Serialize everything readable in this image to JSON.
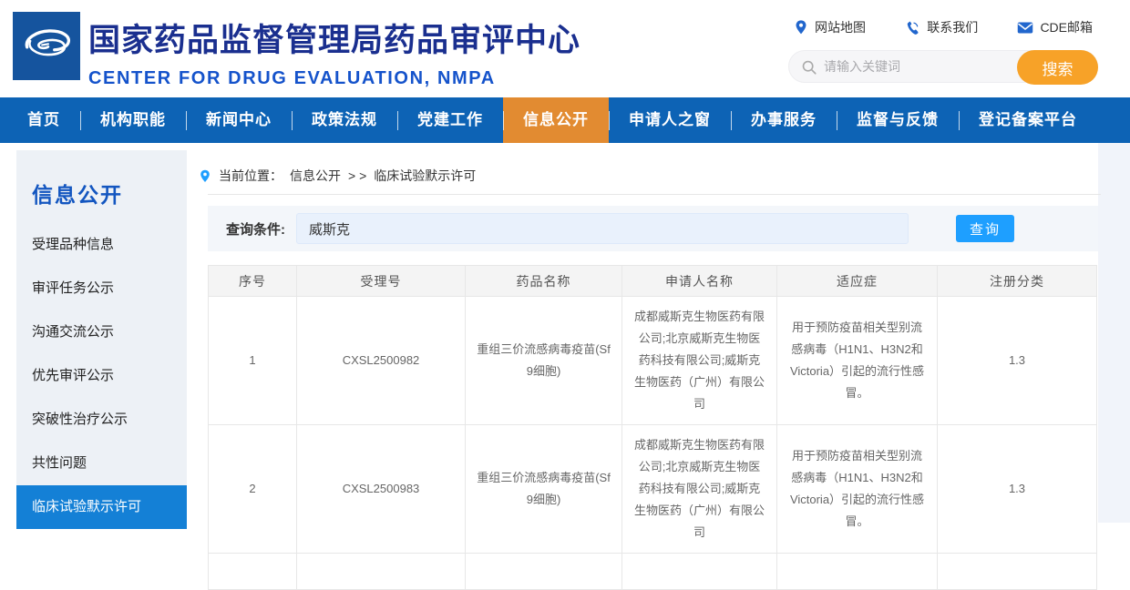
{
  "theme": {
    "logo-blue": "#15549e",
    "title-blue": "#1a2f8f",
    "subtitle-blue": "#1553cb",
    "icon-blue": "#2166cd",
    "search-orange": "#f7a228",
    "nav-blue": "#0d63b5",
    "nav-orange": "#e28b31",
    "sidebar-bg": "#edf1f6",
    "sidebar-title-blue": "#1356c0",
    "sidebar-active-blue": "#1480d6",
    "query-bg": "#f3f6fa",
    "query-input-bg": "#e9f1fc",
    "query-btn-blue": "#1e9fff",
    "th-bg": "#f4f4f4",
    "tbl-border": "#e7e7e7"
  },
  "header": {
    "title": "国家药品监督管理局药品审评中心",
    "subtitle": "CENTER FOR DRUG EVALUATION, NMPA",
    "quick_links": [
      {
        "label": "网站地图",
        "icon": "location-pin-icon"
      },
      {
        "label": "联系我们",
        "icon": "phone-icon"
      },
      {
        "label": "CDE邮箱",
        "icon": "envelope-icon"
      }
    ],
    "search": {
      "placeholder": "请输入关键词",
      "button_label": "搜索",
      "icon": "search-icon"
    }
  },
  "nav": {
    "items": [
      {
        "label": "首页",
        "active": false
      },
      {
        "label": "机构职能",
        "active": false
      },
      {
        "label": "新闻中心",
        "active": false
      },
      {
        "label": "政策法规",
        "active": false
      },
      {
        "label": "党建工作",
        "active": false
      },
      {
        "label": "信息公开",
        "active": true
      },
      {
        "label": "申请人之窗",
        "active": false
      },
      {
        "label": "办事服务",
        "active": false
      },
      {
        "label": "监督与反馈",
        "active": false
      },
      {
        "label": "登记备案平台",
        "active": false
      }
    ]
  },
  "sidebar": {
    "title": "信息公开",
    "items": [
      {
        "label": "受理品种信息",
        "active": false
      },
      {
        "label": "审评任务公示",
        "active": false
      },
      {
        "label": "沟通交流公示",
        "active": false
      },
      {
        "label": "优先审评公示",
        "active": false
      },
      {
        "label": "突破性治疗公示",
        "active": false
      },
      {
        "label": "共性问题",
        "active": false
      },
      {
        "label": "临床试验默示许可",
        "active": true
      }
    ]
  },
  "breadcrumb": {
    "prefix": "当前位置：",
    "section": "信息公开",
    "separator": ">  >",
    "current": "临床试验默示许可",
    "icon": "location-pin-icon"
  },
  "query": {
    "label": "查询条件:",
    "value": "威斯克",
    "button_label": "查询"
  },
  "table": {
    "columns": [
      "序号",
      "受理号",
      "药品名称",
      "申请人名称",
      "适应症",
      "注册分类"
    ],
    "rows": [
      {
        "seq": "1",
        "acceptance_no": "CXSL2500982",
        "drug_name": "重组三价流感病毒疫苗(Sf9细胞)",
        "applicant": "成都威斯克生物医药有限公司;北京威斯克生物医药科技有限公司;威斯克生物医药（广州）有限公司",
        "indication": "用于预防疫苗相关型别流感病毒（H1N1、H3N2和Victoria）引起的流行性感冒。",
        "category": "1.3"
      },
      {
        "seq": "2",
        "acceptance_no": "CXSL2500983",
        "drug_name": "重组三价流感病毒疫苗(Sf9细胞)",
        "applicant": "成都威斯克生物医药有限公司;北京威斯克生物医药科技有限公司;威斯克生物医药（广州）有限公司",
        "indication": "用于预防疫苗相关型别流感病毒（H1N1、H3N2和Victoria）引起的流行性感冒。",
        "category": "1.3"
      }
    ]
  }
}
